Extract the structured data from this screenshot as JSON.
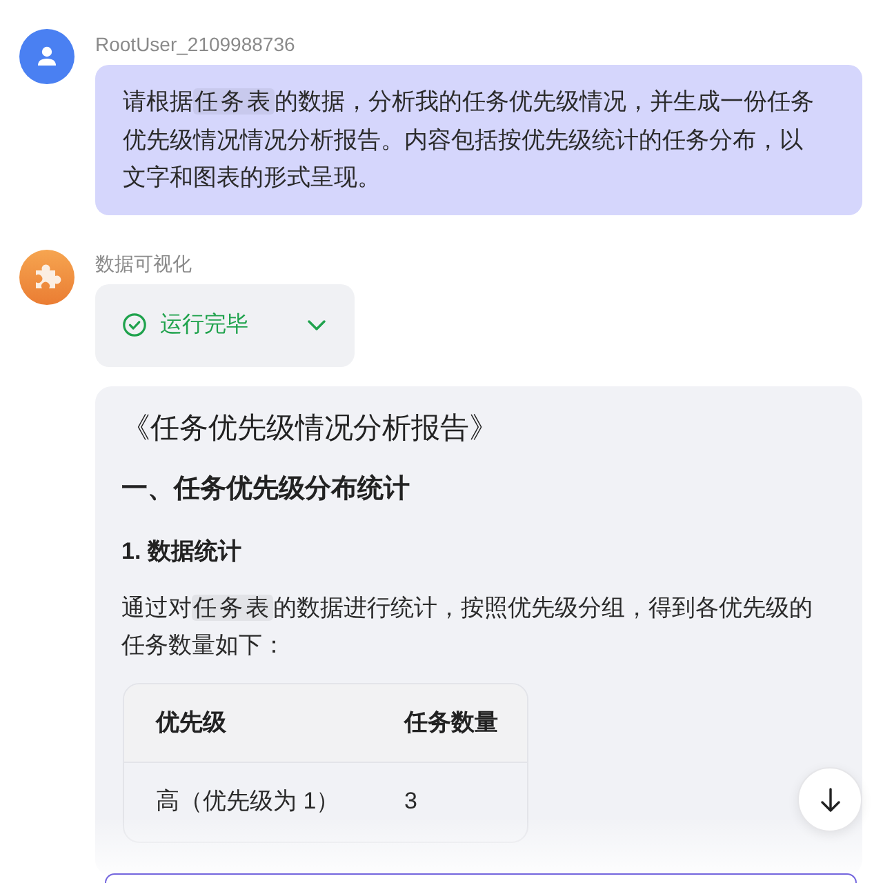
{
  "messages": [
    {
      "kind": "user",
      "author": "RootUser_2109988736",
      "segments": [
        {
          "kind": "plain",
          "text": "请根据"
        },
        {
          "kind": "reference",
          "text": "任务表"
        },
        {
          "kind": "plain",
          "text": "的数据，分析我的任务优先级情况，并生成一份任务优先级情况情况分析报告。内容包括按优先级统计的任务分布，以文字和图表的形式呈现。"
        }
      ]
    },
    {
      "kind": "bot",
      "author": "数据可视化",
      "status": {
        "label": "运行完毕",
        "expanded": false
      },
      "report": {
        "title": "《任务优先级情况分析报告》",
        "heading": "一、任务优先级分布统计",
        "subheading": "1. 数据统计",
        "paragraph": [
          {
            "kind": "plain",
            "text": "通过对"
          },
          {
            "kind": "reference",
            "text": "任务表"
          },
          {
            "kind": "plain",
            "text": "的数据进行统计，按照优先级分组，得到各优先级的任务数量如下："
          }
        ],
        "table": {
          "columns": [
            "优先级",
            "任务数量"
          ],
          "rows": [
            [
              "高（优先级为 1）",
              "3"
            ]
          ]
        }
      }
    }
  ]
}
